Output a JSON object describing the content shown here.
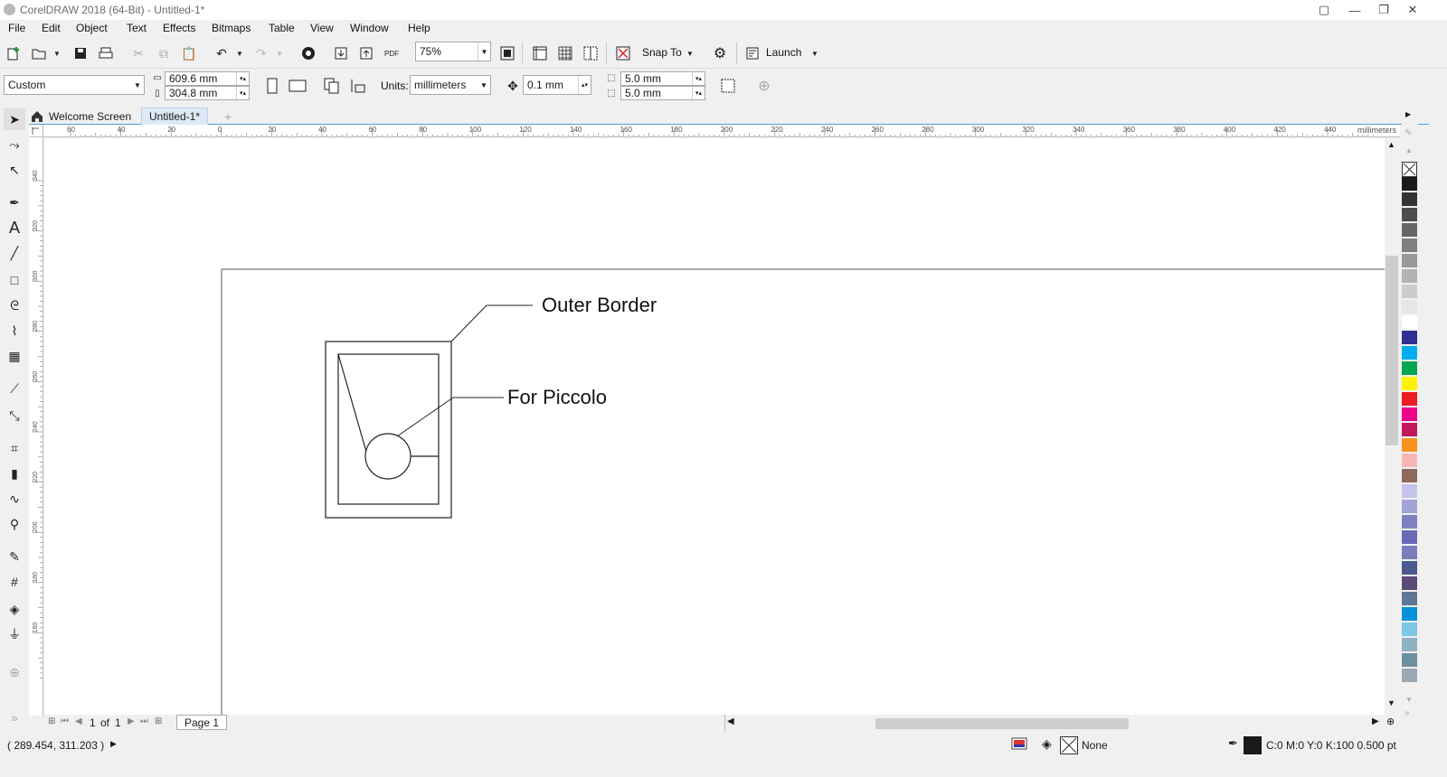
{
  "window": {
    "title": "CorelDRAW 2018 (64-Bit) - Untitled-1*"
  },
  "menu": [
    "File",
    "Edit",
    "Object",
    "Text",
    "Effects",
    "Bitmaps",
    "Table",
    "View",
    "Window",
    "Help"
  ],
  "toolbar": {
    "zoom_value": "75%",
    "pdf_label": "PDF",
    "snap_label": "Snap To",
    "launch_label": "Launch"
  },
  "property_bar": {
    "page_preset": "Custom",
    "width": "609.6 mm",
    "height": "304.8 mm",
    "units_label": "Units:",
    "units_value": "millimeters",
    "nudge": "0.1 mm",
    "dup_x": "5.0 mm",
    "dup_y": "5.0 mm"
  },
  "tabs": {
    "welcome": "Welcome Screen",
    "document": "Untitled-1*"
  },
  "rulers": {
    "unit_label": "millimeters",
    "h_ticks": [
      "60",
      "40",
      "20",
      "0",
      "20",
      "40",
      "60",
      "80",
      "100",
      "120",
      "140",
      "160",
      "180",
      "200",
      "220",
      "240",
      "260",
      "280",
      "300",
      "320",
      "340",
      "360",
      "380",
      "400",
      "420",
      "440"
    ],
    "v_ticks": [
      "340",
      "320",
      "300",
      "280",
      "260",
      "240",
      "220",
      "200",
      "180",
      "160"
    ]
  },
  "drawing": {
    "label_outer": "Outer Border",
    "label_piccolo": "For Piccolo"
  },
  "page_nav": {
    "current": "1",
    "of_label": "of",
    "total": "1",
    "page_tab": "Page 1"
  },
  "status": {
    "coords": "( 289.454, 311.203 )",
    "fill_label": "None",
    "outline_info": "C:0 M:0 Y:0 K:100  0.500 pt"
  },
  "palette_colors": [
    "#1a1a1a",
    "#333333",
    "#4d4d4d",
    "#666666",
    "#7f7f7f",
    "#999999",
    "#b3b3b3",
    "#cccccc",
    "#e6e6e6",
    "#ffffff",
    "#2e3192",
    "#00aeef",
    "#00a651",
    "#fff200",
    "#ed1c24",
    "#ec008c",
    "#c2185b",
    "#f7941d",
    "#f9b5b5",
    "#8b6b5a",
    "#c5c5e8",
    "#a3a3d6",
    "#8080c0",
    "#6a6ab8",
    "#7d7dbd",
    "#4b5a8c",
    "#5a4a7a",
    "#5f7694",
    "#0091d7",
    "#7ec8e3",
    "#8fb1c3",
    "#6f8fa0",
    "#9aa8b3"
  ]
}
